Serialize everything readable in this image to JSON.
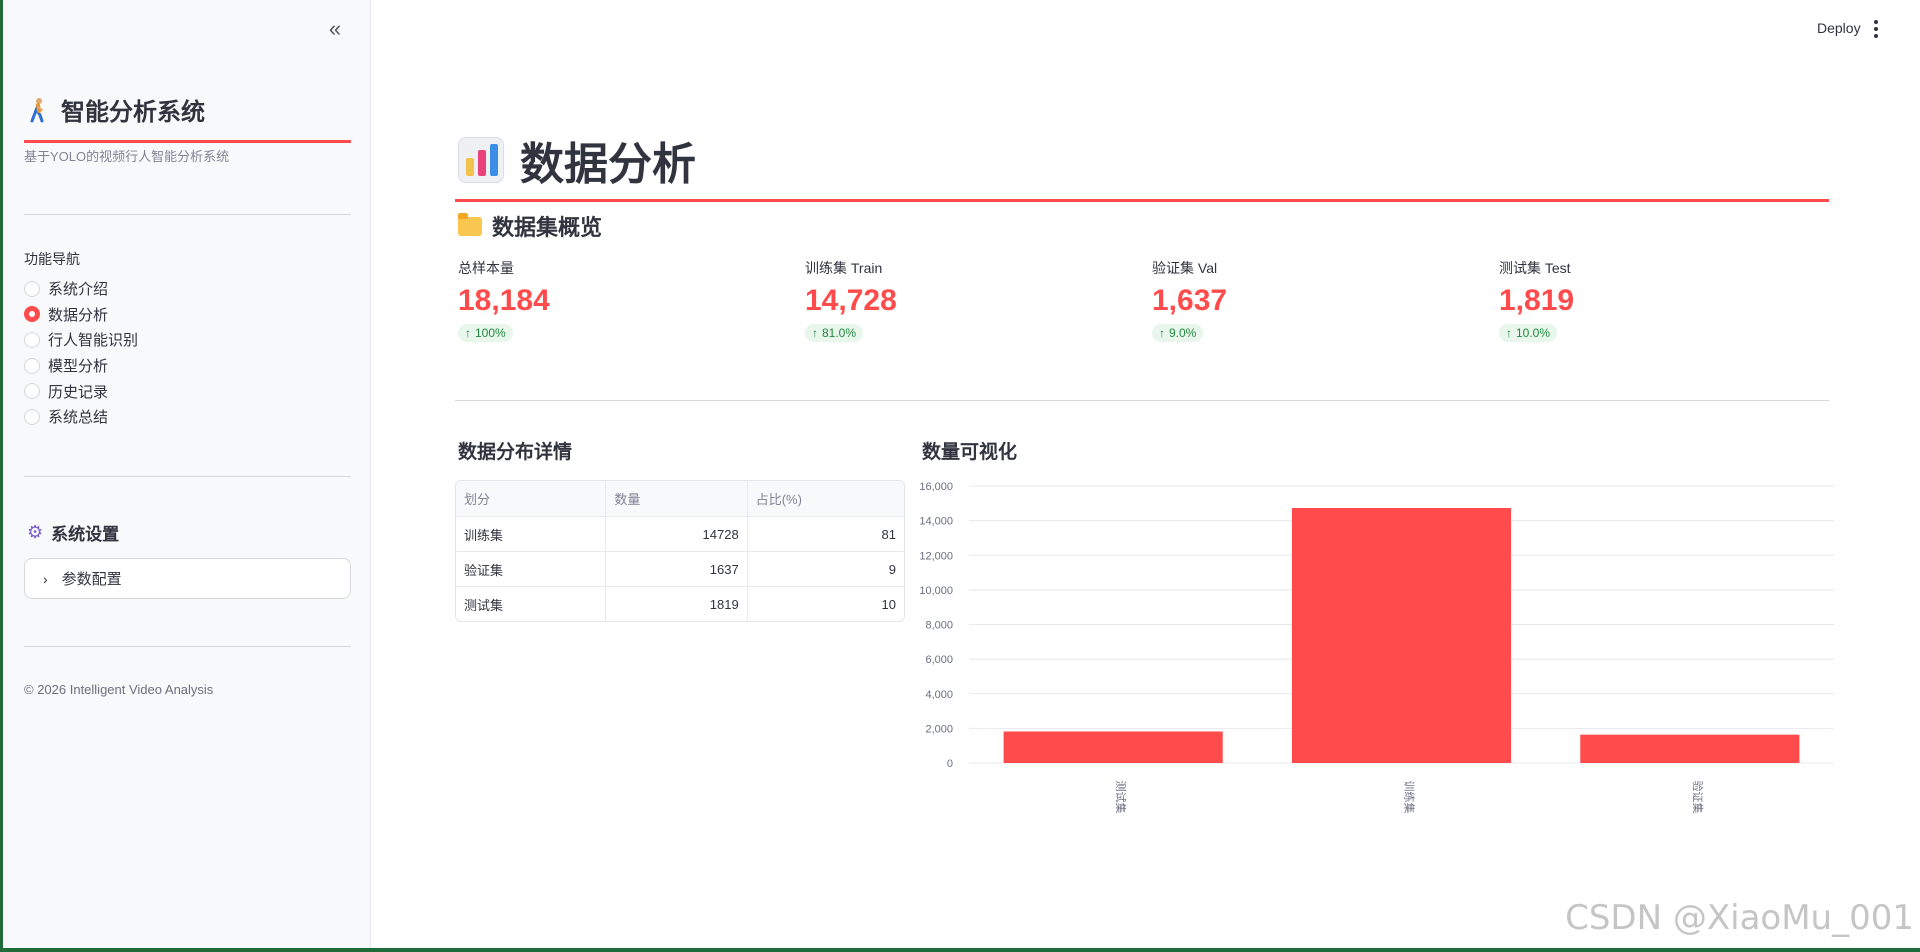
{
  "sidebar": {
    "collapse_icon": "double-chevron-left-icon",
    "title": "智能分析系统",
    "subtitle": "基于YOLO的视频行人智能分析系统",
    "nav_label": "功能导航",
    "nav_items": [
      {
        "label": "系统介绍",
        "selected": false
      },
      {
        "label": "数据分析",
        "selected": true
      },
      {
        "label": "行人智能识别",
        "selected": false
      },
      {
        "label": "模型分析",
        "selected": false
      },
      {
        "label": "历史记录",
        "selected": false
      },
      {
        "label": "系统总结",
        "selected": false
      }
    ],
    "settings_title": "系统设置",
    "expander_label": "参数配置",
    "copyright": "© 2026 Intelligent Video Analysis"
  },
  "header": {
    "deploy_label": "Deploy"
  },
  "main": {
    "title": "数据分析",
    "overview_title": "数据集概览",
    "metrics": [
      {
        "label": "总样本量",
        "value": "18,184",
        "delta": "100%"
      },
      {
        "label": "训练集 Train",
        "value": "14,728",
        "delta": "81.0%"
      },
      {
        "label": "验证集 Val",
        "value": "1,637",
        "delta": "9.0%"
      },
      {
        "label": "测试集 Test",
        "value": "1,819",
        "delta": "10.0%"
      }
    ],
    "table_title": "数据分布详情",
    "table": {
      "headers": [
        "划分",
        "数量",
        "占比(%)"
      ],
      "rows": [
        [
          "训练集",
          "14728",
          "81"
        ],
        [
          "验证集",
          "1637",
          "9"
        ],
        [
          "测试集",
          "1819",
          "10"
        ]
      ]
    },
    "chart_title": "数量可视化"
  },
  "colors": {
    "accent": "#ff4b4b",
    "delta_bg": "#e8f6ec",
    "delta_fg": "#21893f"
  },
  "watermark": "CSDN @XiaoMu_001",
  "chart_data": {
    "type": "bar",
    "categories": [
      "测试集",
      "训练集",
      "验证集"
    ],
    "values": [
      1819,
      14728,
      1637
    ],
    "ylim": [
      0,
      16000
    ],
    "yticks": [
      0,
      2000,
      4000,
      6000,
      8000,
      10000,
      12000,
      14000,
      16000
    ],
    "ytick_labels": [
      "0",
      "2,000",
      "4,000",
      "6,000",
      "8,000",
      "10,000",
      "12,000",
      "14,000",
      "16,000"
    ],
    "xlabel": "",
    "ylabel": "",
    "grid": true,
    "color": "#ff4b4b"
  }
}
